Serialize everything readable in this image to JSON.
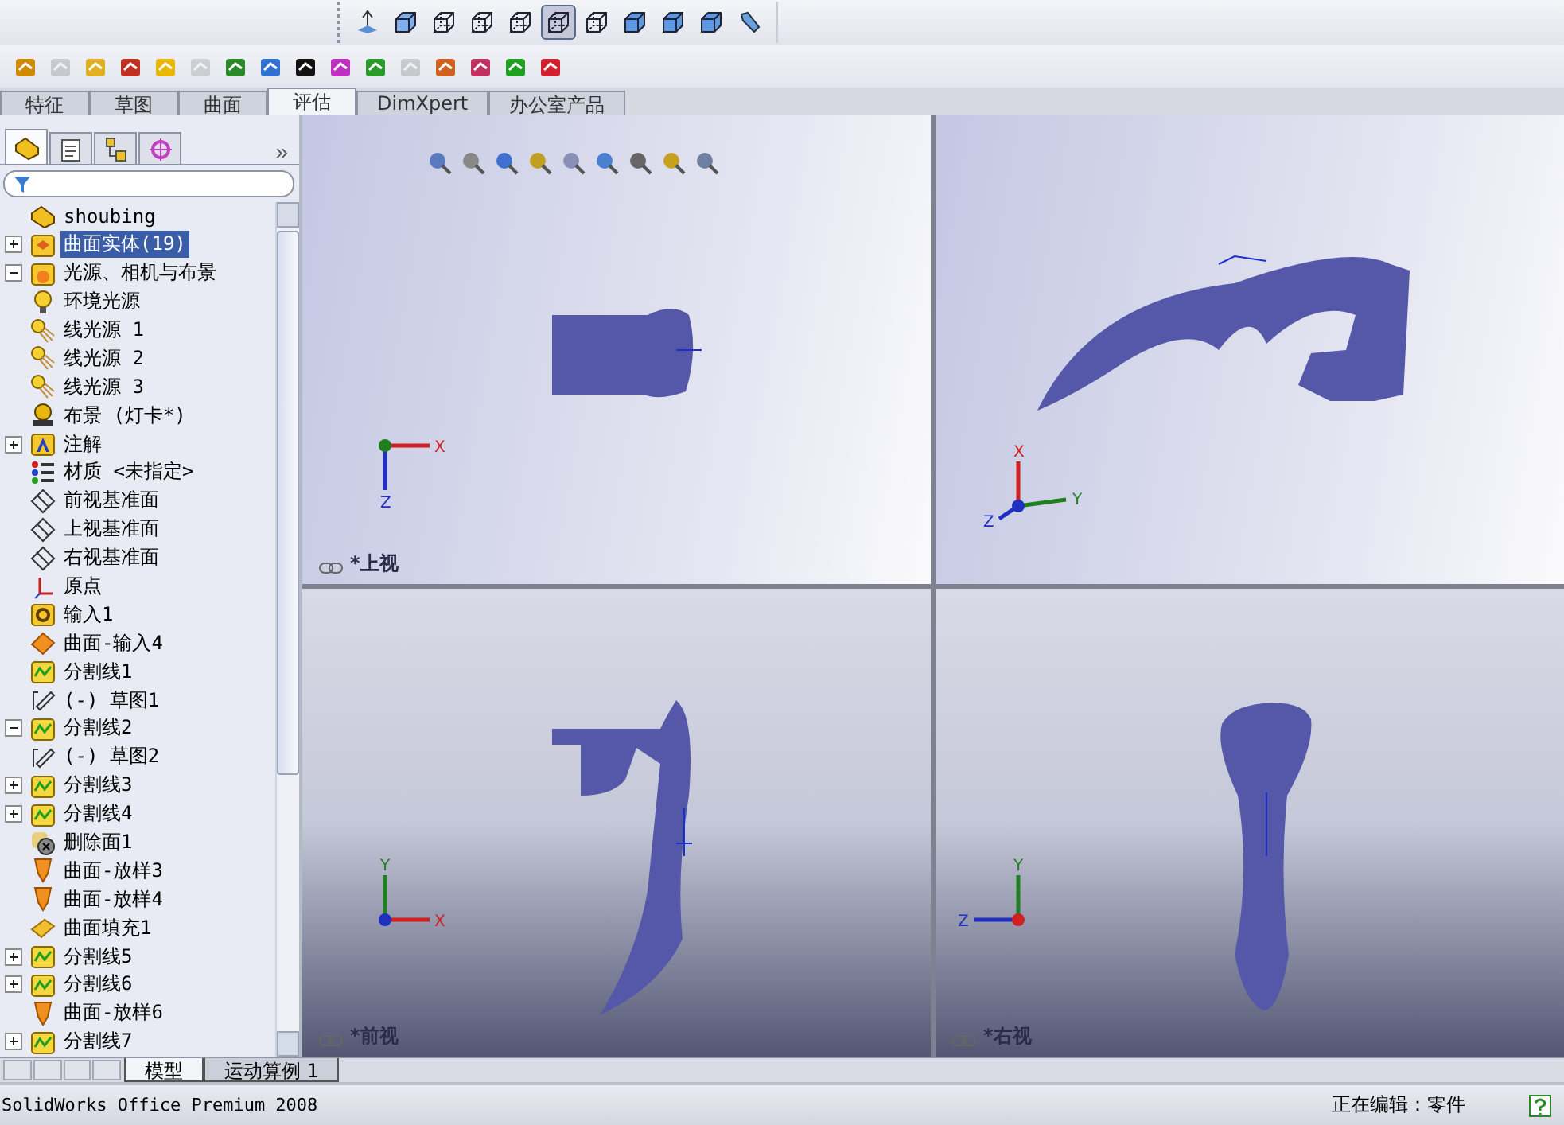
{
  "view_buttons": [
    {
      "kind": "normal",
      "selected": false
    },
    {
      "kind": "shaded-edges",
      "selected": false
    },
    {
      "kind": "wire",
      "selected": false
    },
    {
      "kind": "wire",
      "selected": false
    },
    {
      "kind": "wire",
      "selected": false
    },
    {
      "kind": "wire",
      "selected": true
    },
    {
      "kind": "wire",
      "selected": false
    },
    {
      "kind": "shaded",
      "selected": false
    },
    {
      "kind": "shaded",
      "selected": false
    },
    {
      "kind": "shaded",
      "selected": false
    },
    {
      "kind": "lens",
      "selected": false
    }
  ],
  "tools": [
    {
      "disabled": false
    },
    {
      "disabled": true
    },
    {
      "disabled": false
    },
    {
      "disabled": false
    },
    {
      "disabled": false
    },
    {
      "disabled": true
    },
    {
      "disabled": false
    },
    {
      "disabled": false
    },
    {
      "disabled": false
    },
    {
      "disabled": false
    },
    {
      "disabled": false
    },
    {
      "disabled": true
    },
    {
      "disabled": false
    },
    {
      "disabled": false
    },
    {
      "disabled": false
    },
    {
      "disabled": false
    }
  ],
  "command_tabs": [
    {
      "label": "特征",
      "selected": false
    },
    {
      "label": "草图",
      "selected": false
    },
    {
      "label": "曲面",
      "selected": false
    },
    {
      "label": "评估",
      "selected": true
    },
    {
      "label": "DimXpert",
      "selected": false
    },
    {
      "label": "办公室产品",
      "selected": false
    }
  ],
  "panel_tabs": [
    {
      "kind": "tree",
      "selected": true
    },
    {
      "kind": "property",
      "selected": false
    },
    {
      "kind": "config",
      "selected": false
    },
    {
      "kind": "dim",
      "selected": false
    }
  ],
  "panel_more": "»",
  "tree": [
    {
      "label": "shoubing",
      "kind": "part",
      "selected": false,
      "children": [
        {
          "label": "曲面实体(19)",
          "kind": "bodies",
          "selected": true,
          "expanded": false
        },
        {
          "label": "光源、相机与布景",
          "kind": "lights",
          "selected": false,
          "expanded": true,
          "children": [
            {
              "label": "环境光源",
              "kind": "bulb",
              "selected": false
            },
            {
              "label": "线光源 1",
              "kind": "light",
              "selected": false
            },
            {
              "label": "线光源 2",
              "kind": "light",
              "selected": false
            },
            {
              "label": "线光源 3",
              "kind": "light",
              "selected": false
            },
            {
              "label": "布景 (灯卡*)",
              "kind": "scene",
              "selected": false
            }
          ]
        },
        {
          "label": "注解",
          "kind": "annotation",
          "selected": false,
          "expanded": false
        },
        {
          "label": "材质 <未指定>",
          "kind": "material",
          "selected": false
        },
        {
          "label": "前视基准面",
          "kind": "plane",
          "selected": false
        },
        {
          "label": "上视基准面",
          "kind": "plane",
          "selected": false
        },
        {
          "label": "右视基准面",
          "kind": "plane",
          "selected": false
        },
        {
          "label": "原点",
          "kind": "origin",
          "selected": false
        },
        {
          "label": "输入1",
          "kind": "import",
          "selected": false
        },
        {
          "label": "曲面-输入4",
          "kind": "surface",
          "selected": false
        },
        {
          "label": "分割线1",
          "kind": "split",
          "selected": false
        },
        {
          "label": "(-) 草图1",
          "kind": "sketch",
          "selected": false
        },
        {
          "label": "分割线2",
          "kind": "split",
          "selected": false,
          "expanded": true,
          "children": [
            {
              "label": "(-) 草图2",
              "kind": "sketch",
              "selected": false
            }
          ]
        },
        {
          "label": "分割线3",
          "kind": "split",
          "selected": false,
          "expanded": false
        },
        {
          "label": "分割线4",
          "kind": "split",
          "selected": false,
          "expanded": false
        },
        {
          "label": "删除面1",
          "kind": "delete",
          "selected": false
        },
        {
          "label": "曲面-放样3",
          "kind": "loft",
          "selected": false
        },
        {
          "label": "曲面-放样4",
          "kind": "loft",
          "selected": false
        },
        {
          "label": "曲面填充1",
          "kind": "fill",
          "selected": false
        },
        {
          "label": "分割线5",
          "kind": "split",
          "selected": false,
          "expanded": false
        },
        {
          "label": "分割线6",
          "kind": "split",
          "selected": false,
          "expanded": false
        },
        {
          "label": "曲面-放样6",
          "kind": "loft",
          "selected": false
        },
        {
          "label": "分割线7",
          "kind": "split",
          "selected": false,
          "expanded": false
        }
      ]
    }
  ],
  "viewports": [
    {
      "kind": "top",
      "label": "*上视",
      "axes": [
        "X",
        "Z"
      ]
    },
    {
      "kind": "iso",
      "axes": [
        "X",
        "Y",
        "Z"
      ]
    },
    {
      "kind": "front",
      "label": "*前视",
      "axes": [
        "Y",
        "X"
      ]
    },
    {
      "kind": "right",
      "label": "*右视",
      "axes": [
        "Y",
        "Z"
      ]
    }
  ],
  "bottom_tabs": [
    {
      "label": "模型",
      "selected": true
    },
    {
      "label": "运动算例 1",
      "selected": false
    }
  ],
  "status_bar": {
    "product": "SolidWorks Office Premium 2008",
    "mode": "正在编辑：零件"
  }
}
